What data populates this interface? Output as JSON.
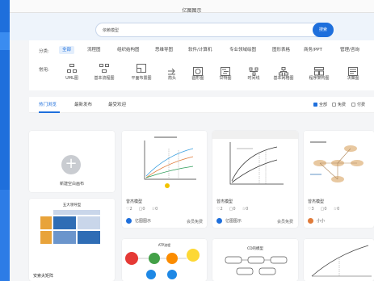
{
  "window": {
    "title": "亿图图示"
  },
  "search": {
    "value": "依赖模型",
    "button": "搜索"
  },
  "filters": {
    "category_label": "分类:",
    "categories": [
      "全部",
      "流程图",
      "组织结构图",
      "思维导图",
      "软件/计算机",
      "专业领域绘图",
      "图形表格",
      "商务/PPT",
      "管理/咨询"
    ],
    "tools_label": "常用:",
    "tools": [
      "UML图",
      "基本流程图",
      "平面布置图",
      "箭头",
      "圆形图",
      "甘特图",
      "时间线",
      "基本网格图",
      "程序架构图",
      "决策图"
    ]
  },
  "tabs": [
    "热门浏览",
    "最新发布",
    "最受欢迎"
  ],
  "checkboxes": [
    "全部",
    "免费",
    "付费"
  ],
  "new_card": {
    "label": "新建空白画布"
  },
  "cards": [
    {
      "title": "曾杰模型",
      "likes": "2",
      "comments": "0",
      "favorites": "0",
      "author": "亿图图示",
      "price": "会员免费"
    },
    {
      "title": "曾杰模型",
      "likes": "2",
      "comments": "0",
      "favorites": "0",
      "author": "亿图图示",
      "price": "会员免费"
    },
    {
      "title": "曾杰模型",
      "likes": "3",
      "comments": "0",
      "favorites": "0",
      "author": "小小",
      "price": ""
    }
  ],
  "bottom_cards": [
    {
      "thumb_title": "五大领导型",
      "title": "安索夫矩阵"
    },
    {
      "thumb_title": "ATP流程"
    },
    {
      "thumb_title": "CD的模型"
    }
  ],
  "colors": {
    "accent": "#1e6fdc",
    "page_bg": "#f4f5f7"
  }
}
